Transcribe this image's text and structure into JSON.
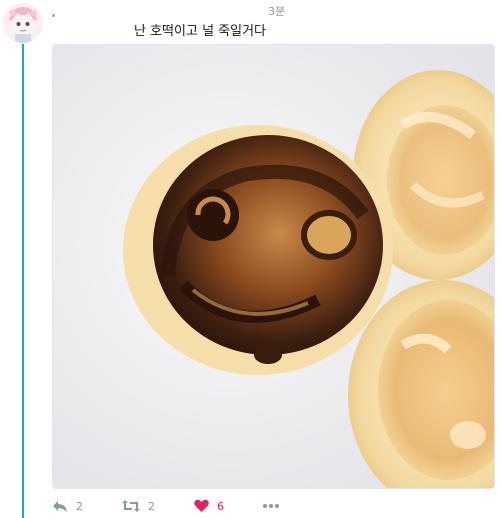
{
  "tweet": {
    "text": "난 호떡이고 널 죽일거다",
    "timestamp": "3분",
    "avatar_icon": "anime-avatar-icon",
    "media_alt_icon": "photo-of-hotteok-pancakes"
  },
  "actions": {
    "reply": {
      "icon": "reply-icon",
      "count": "2"
    },
    "retweet": {
      "icon": "retweet-icon",
      "count": "2"
    },
    "like": {
      "icon": "heart-icon",
      "count": "6",
      "color": "#e0245e"
    },
    "more": {
      "icon": "more-dots-icon"
    }
  },
  "colors": {
    "accent": "#1da1f2",
    "muted_text": "#8899a6"
  }
}
